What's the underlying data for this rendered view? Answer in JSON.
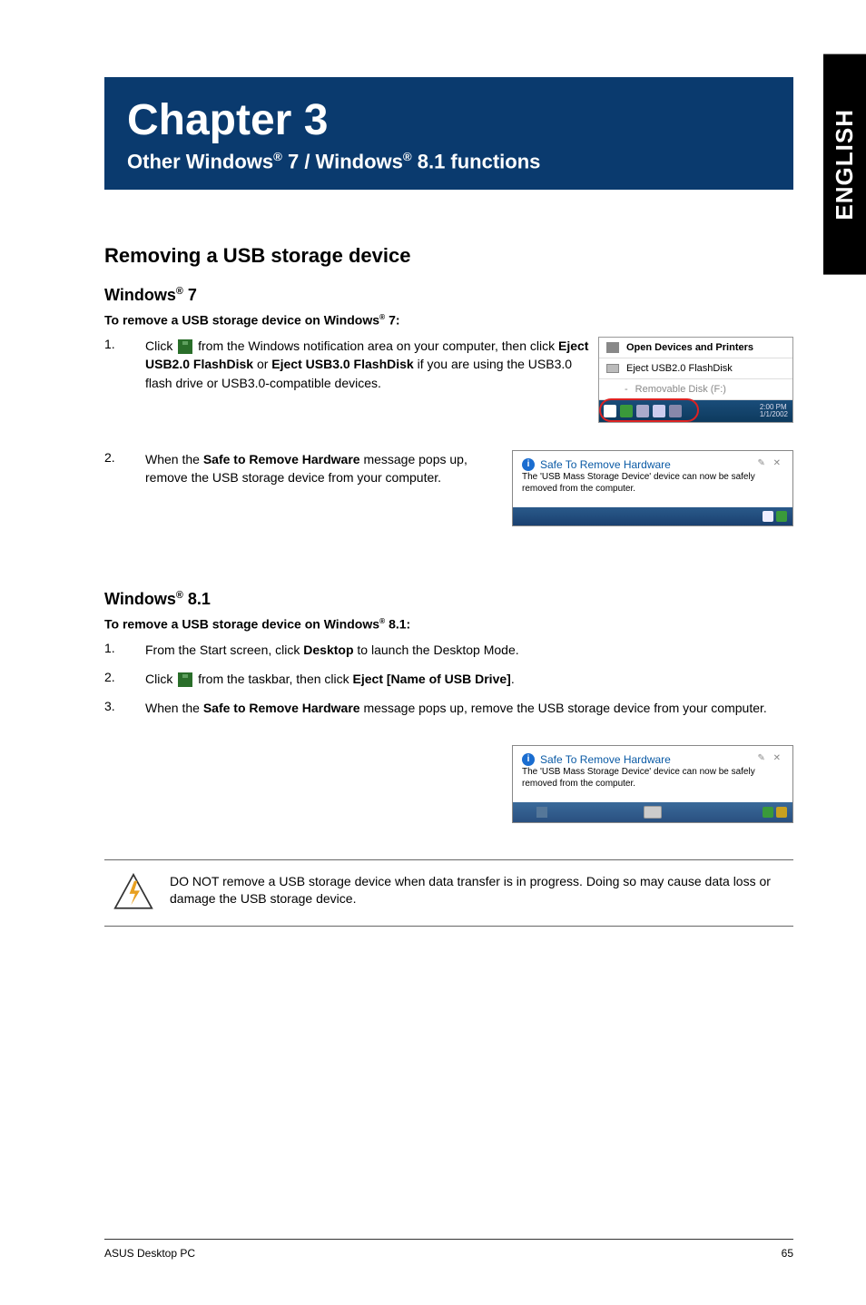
{
  "chapter": {
    "title": "Chapter 3",
    "subtitle_prefix": "Other Windows",
    "subtitle_mid": " 7 / Windows",
    "subtitle_suffix": " 8.1 functions"
  },
  "language_tab": "ENGLISH",
  "section1": {
    "title": "Removing a USB storage device"
  },
  "win7": {
    "heading_prefix": "Windows",
    "heading_suffix": " 7",
    "intro_prefix": "To remove a USB storage device on Windows",
    "intro_suffix": " 7:",
    "step1_num": "1.",
    "step1_a": "Click ",
    "step1_b": " from the Windows notification area on your computer, then click ",
    "step1_bold1": "Eject USB2.0 FlashDisk",
    "step1_c": " or ",
    "step1_bold2": "Eject USB3.0 FlashDisk",
    "step1_d": " if you are using the USB3.0 flash drive or USB3.0-compatible devices.",
    "step2_num": "2.",
    "step2_a": "When the ",
    "step2_bold": "Safe to Remove Hardware",
    "step2_b": " message pops up, remove the USB storage device from your computer."
  },
  "popup": {
    "open_devices": "Open Devices and Printers",
    "eject": "Eject USB2.0 FlashDisk",
    "removable": "Removable Disk (F:)",
    "time1": "2:00 PM",
    "time2": "1/1/2002"
  },
  "balloon": {
    "title": "Safe To Remove Hardware",
    "text": "The 'USB Mass Storage Device' device can now be safely removed from the computer."
  },
  "win81": {
    "heading_prefix": "Windows",
    "heading_suffix": " 8.1",
    "intro_prefix": "To remove a USB storage device on Windows",
    "intro_suffix": " 8.1:",
    "step1_num": "1.",
    "step1_a": "From the Start screen, click ",
    "step1_bold": "Desktop",
    "step1_b": " to launch the Desktop Mode.",
    "step2_num": "2.",
    "step2_a": "Click ",
    "step2_b": " from the taskbar, then click ",
    "step2_bold": "Eject [Name of USB Drive]",
    "step2_c": ".",
    "step3_num": "3.",
    "step3_a": "When the ",
    "step3_bold": "Safe to Remove Hardware",
    "step3_b": " message pops up, remove the USB storage device from your computer."
  },
  "warning": "DO NOT remove a USB storage device when data transfer is in progress. Doing so may cause data loss or damage the USB storage device.",
  "footer": {
    "left": "ASUS Desktop PC",
    "right": "65"
  }
}
